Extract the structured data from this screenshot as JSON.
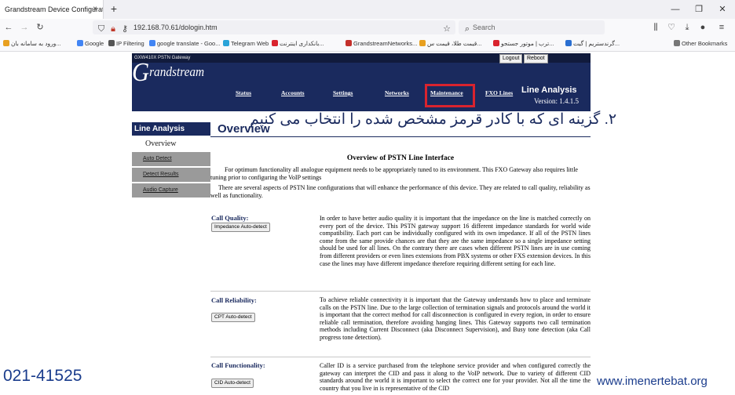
{
  "browser": {
    "tab_title": "Grandstream Device Configuration",
    "tab_close": "×",
    "new_tab": "+",
    "url": "192.168.70.61/dologin.htm",
    "search_placeholder": "Search",
    "bookmarks": [
      "ورود به سامانه بان...",
      "Google",
      "IP Filtering",
      "google translate - Goo...",
      "Telegram Web",
      "بانکداری اینترنت...",
      "GrandstreamNetworks...",
      "قیمت طلا، قیمت س...",
      "ترب | موتور جستجو...",
      "گرندستریم | گیت...",
      "Other Bookmarks"
    ],
    "bookmark_colors": [
      "#e8a020",
      "#4285f4",
      "#555555",
      "#4285f4",
      "#2aa3d8",
      "#d9232e",
      "#c4302b",
      "#e8a020",
      "#d9232e",
      "#2a6fd1",
      "#777777"
    ],
    "window_controls": [
      "—",
      "❐",
      "✕"
    ]
  },
  "header": {
    "model": "GXW410X PSTN Gateway",
    "logout": "Logout",
    "reboot": "Reboot",
    "logo": "Grandstream",
    "nav": [
      "Status",
      "Accounts",
      "Settings",
      "Networks",
      "Maintenance",
      "FXO Lines"
    ],
    "title": "Line Analysis",
    "version": "Version: 1.4.1.5"
  },
  "caption": "۲. گزینه ای که با کادر قرمز مشخص شده را انتخاب می کنیم",
  "highlight_color": "#d9232e",
  "sidebar": {
    "heading": "Line Analysis",
    "active": "Overview",
    "items": [
      "Auto Detect",
      "Detect Results",
      "Audio Capture"
    ]
  },
  "main": {
    "title": "Overview",
    "section_title": "Overview of PSTN Line Interface",
    "intro": "For optimum functionality all analogue equipment needs to be appropriately tuned to its environment. This FXO Gateway also requires little tuning prior to configuring the VoIP settings",
    "intro2": "There are several aspects of PSTN line configurations that will enhance the performance of this device. They are related to call quality, reliability as well as functionality.",
    "items": [
      {
        "label": "Call Quality:",
        "button": "Impedance Auto-detect",
        "text": "In order to have better audio quality it is important that the impedance on the line is matched correctly on every port of the device. This PSTN gateway support 16 different impedance standards for world wide compatibility. Each port can be individually configured with its own impedance. If all of the PSTN lines come from the same provide chances are that they are the same impedance so a single impedance setting should be used for all lines. On the contrary there are cases when different PSTN lines are in use coming from different providers or even lines extensions from PBX systems or other FXS extension devices. In this case the lines may have different impedance therefore requiring different setting for each line."
      },
      {
        "label": "Call Reliability:",
        "button": "CPT Auto-detect",
        "text": "To achieve reliable connectivity it is important that the Gateway understands how to place and terminate calls on the PSTN line. Due to the large collection of termination signals and protocols around the world it is important that the correct method for call disconnection is configured in every region, in order to ensure reliable call termination, therefore avoiding hanging lines. This Gateway supports two call termination methods including Current Disconnect (aka Disconnect Supervision), and Busy tone detection (aka Call progress tone detection)."
      },
      {
        "label": "Call Functionality:",
        "button": "CID Auto-detect",
        "text": "Caller ID is a service purchased from the telephone service provider and when configured correctly the gateway can interpret the CID and pass it along to the VoIP network. Due to variety of different CID standards around the world it is important to select the correct one for your provider. Not all the time the country that you live in is representative of the CID"
      }
    ]
  },
  "watermark": {
    "phone": "021-41525",
    "site": "www.imenertebat.org"
  }
}
